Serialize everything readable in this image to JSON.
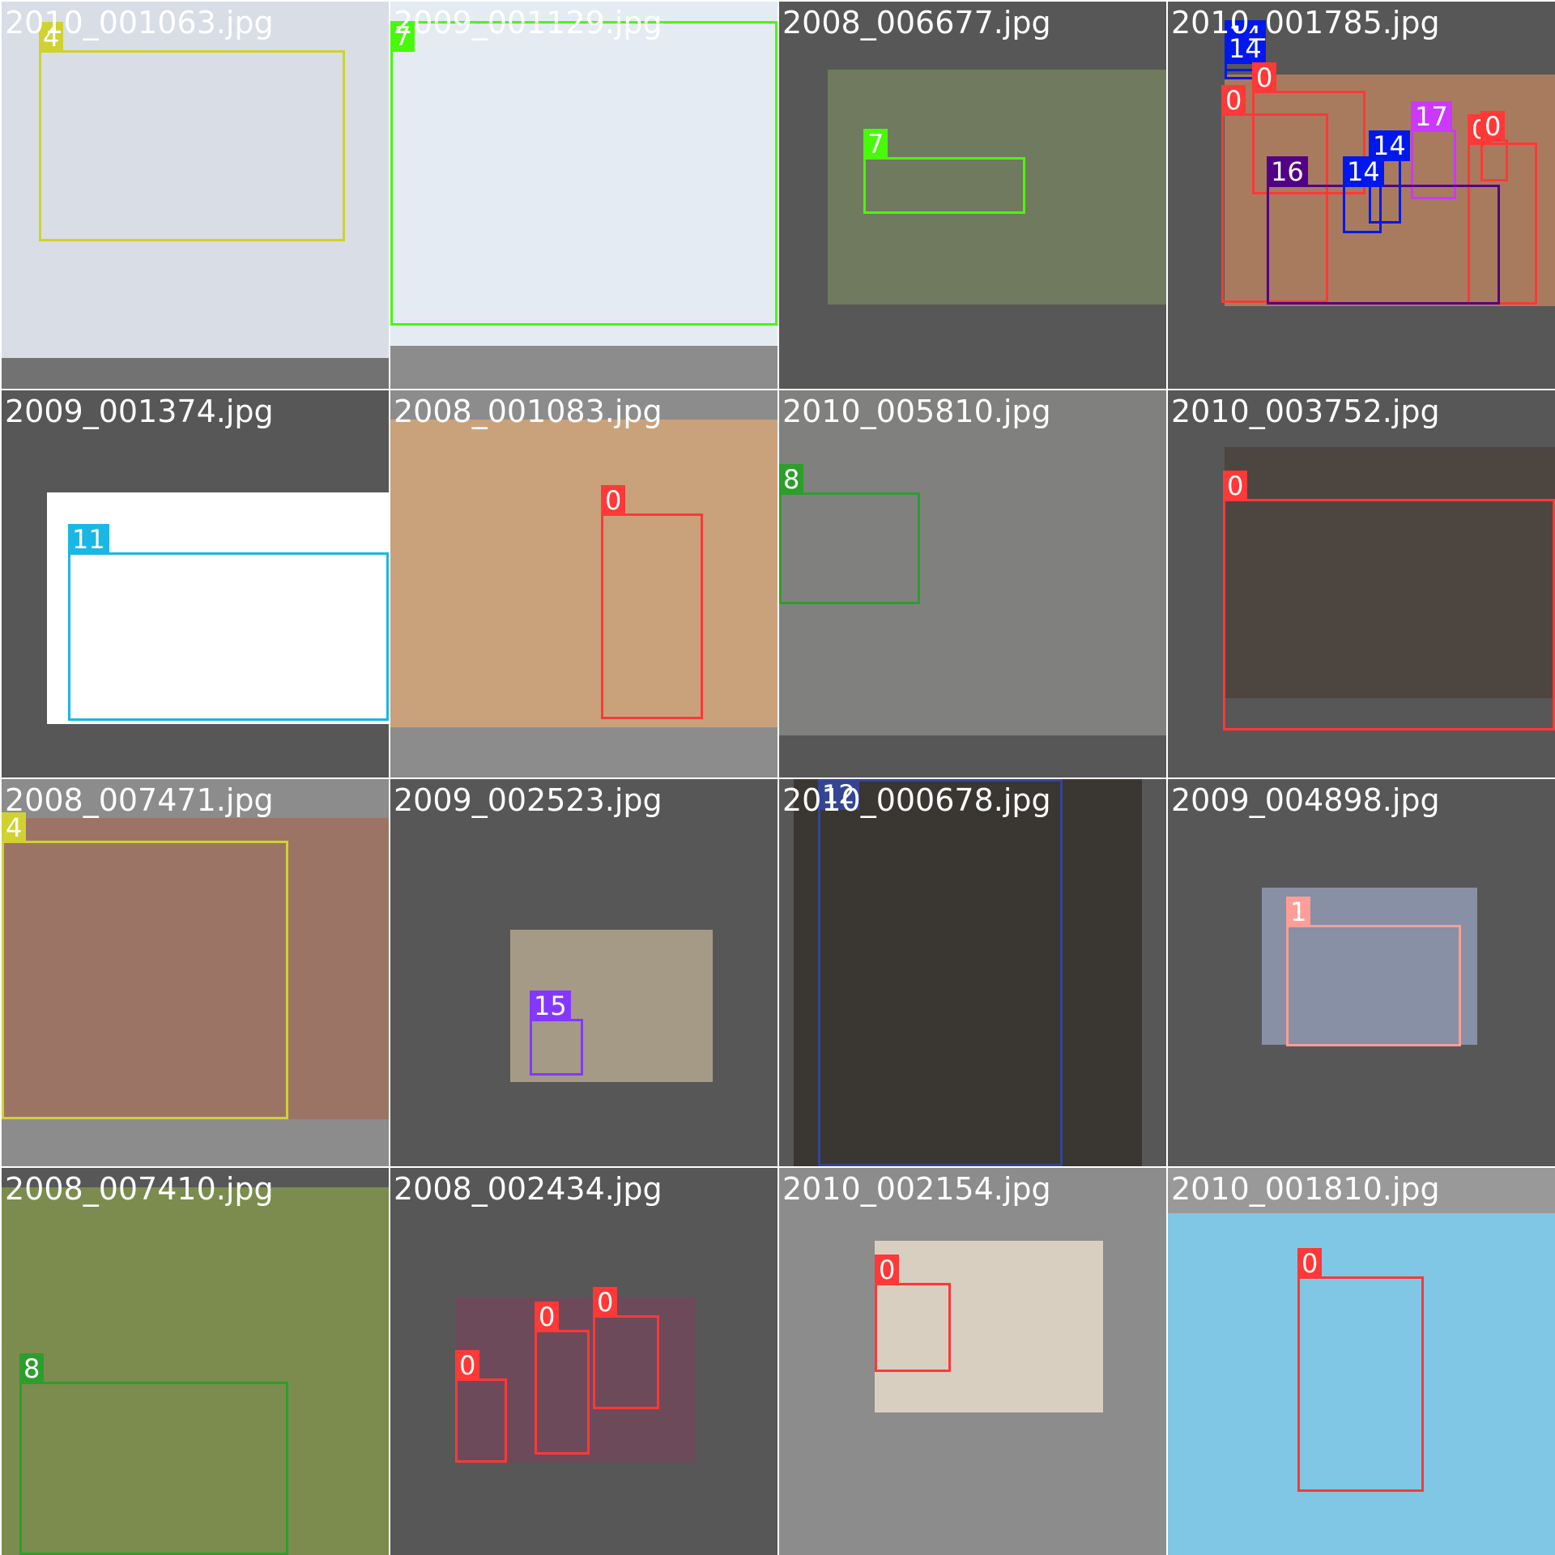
{
  "palette": {
    "0": "#ff3838",
    "1": "#ff9d97",
    "4": "#cfd231",
    "7": "#48f90a",
    "8": "#2c9e2c",
    "11": "#1ab7e5",
    "12": "#344593",
    "14": "#0018ec",
    "15": "#8438ff",
    "16": "#520085",
    "17": "#cb38ff"
  },
  "tiles": [
    {
      "filename": "2010_001063.jpg",
      "labels": [
        "4"
      ]
    },
    {
      "filename": "2009_001129.jpg",
      "labels": [
        "7"
      ]
    },
    {
      "filename": "2008_006677.jpg",
      "labels": [
        "7"
      ]
    },
    {
      "filename": "2010_001785.jpg",
      "labels": [
        "14",
        "14",
        "0",
        "0",
        "0",
        "17",
        "16",
        "14",
        "14",
        "0"
      ]
    },
    {
      "filename": "2009_001374.jpg",
      "labels": [
        "11"
      ]
    },
    {
      "filename": "2008_001083.jpg",
      "labels": [
        "0"
      ]
    },
    {
      "filename": "2010_005810.jpg",
      "labels": [
        "8"
      ]
    },
    {
      "filename": "2010_003752.jpg",
      "labels": [
        "0"
      ]
    },
    {
      "filename": "2008_007471.jpg",
      "labels": [
        "4"
      ]
    },
    {
      "filename": "2009_002523.jpg",
      "labels": [
        "15"
      ]
    },
    {
      "filename": "2010_000678.jpg",
      "labels": [
        "12"
      ]
    },
    {
      "filename": "2009_004898.jpg",
      "labels": [
        "1"
      ]
    },
    {
      "filename": "2008_007410.jpg",
      "labels": [
        "8"
      ]
    },
    {
      "filename": "2008_002434.jpg",
      "labels": [
        "0",
        "0",
        "0"
      ]
    },
    {
      "filename": "2010_002154.jpg",
      "labels": [
        "0"
      ]
    },
    {
      "filename": "2010_001810.jpg",
      "labels": [
        "0"
      ]
    }
  ],
  "tile_colors": {
    "backgrounds": [
      "#727272",
      "#8c8c8c",
      "#575757",
      "#575757",
      "#575757",
      "#8c8c8c",
      "#575757",
      "#575757",
      "#8c8c8c",
      "#575757",
      "#575757",
      "#575757",
      "#575757",
      "#575757",
      "#8c8c8c",
      "#999999"
    ],
    "photos": [
      "#d9dde6",
      "#e4ebf3",
      "#6f7a5e",
      "#a87b5e",
      "#ffffff",
      "#c9a27c",
      "#80817f",
      "#4d4540",
      "#9c7466",
      "#a59a86",
      "#3a3632",
      "#8790a4",
      "#7c8c4e",
      "#6d4a5a",
      "#d9cfc1",
      "#7fc7e4"
    ]
  }
}
